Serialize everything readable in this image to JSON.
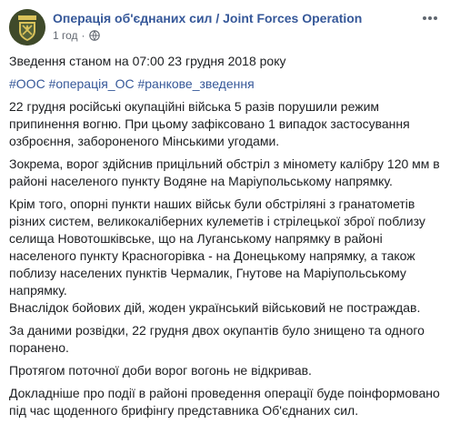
{
  "post": {
    "page_name": "Операція об'єднаних сил / Joint Forces Operation",
    "timestamp": "1 год",
    "separator": "·",
    "privacy_icon": "globe-icon",
    "more_icon": "more-options-icon"
  },
  "content": {
    "p1": "Зведення станом на 07:00 23 грудня 2018 року",
    "hashtags": [
      "#ООС",
      "#операція_ОС",
      "#ранкове_зведення"
    ],
    "p2": "22 грудня російські окупаційні війська 5 разів порушили режим припинення вогню. При цьому зафіксовано 1 випадок застосування озброєння, забороненого Мінськими угодами.",
    "p3": "Зокрема, ворог здійснив прицільний обстріл з міномету калібру 120 мм в районі населеного пункту Водяне на Маріупольському напрямку.",
    "p4": "Крім того, опорні пункти наших військ були обстріляні з гранатометів різних систем, великокаліберних кулеметів і стрілецької зброї поблизу селища Новотошківське, що на Луганському напрямку в районі населеного пункту Красногорівка - на Донецькому напрямку, а також поблизу населених пунктів Чермалик, Гнутове на Маріупольському напрямку.",
    "p5": "Внаслідок бойових дій, жоден український військовий не постраждав.",
    "p6": "За даними розвідки, 22 грудня двох окупантів було знищено та одного поранено.",
    "p7": "Протягом поточної доби ворог вогонь не відкривав.",
    "p8": "Докладніше про події в районі проведення операції буде поінформовано під час щоденного брифінгу представника Об'єднаних сил."
  },
  "colors": {
    "link": "#365899",
    "text": "#1c1e21",
    "meta": "#616770",
    "avatar_bg": "#3f4a2a",
    "emblem": "#d9c25a"
  }
}
